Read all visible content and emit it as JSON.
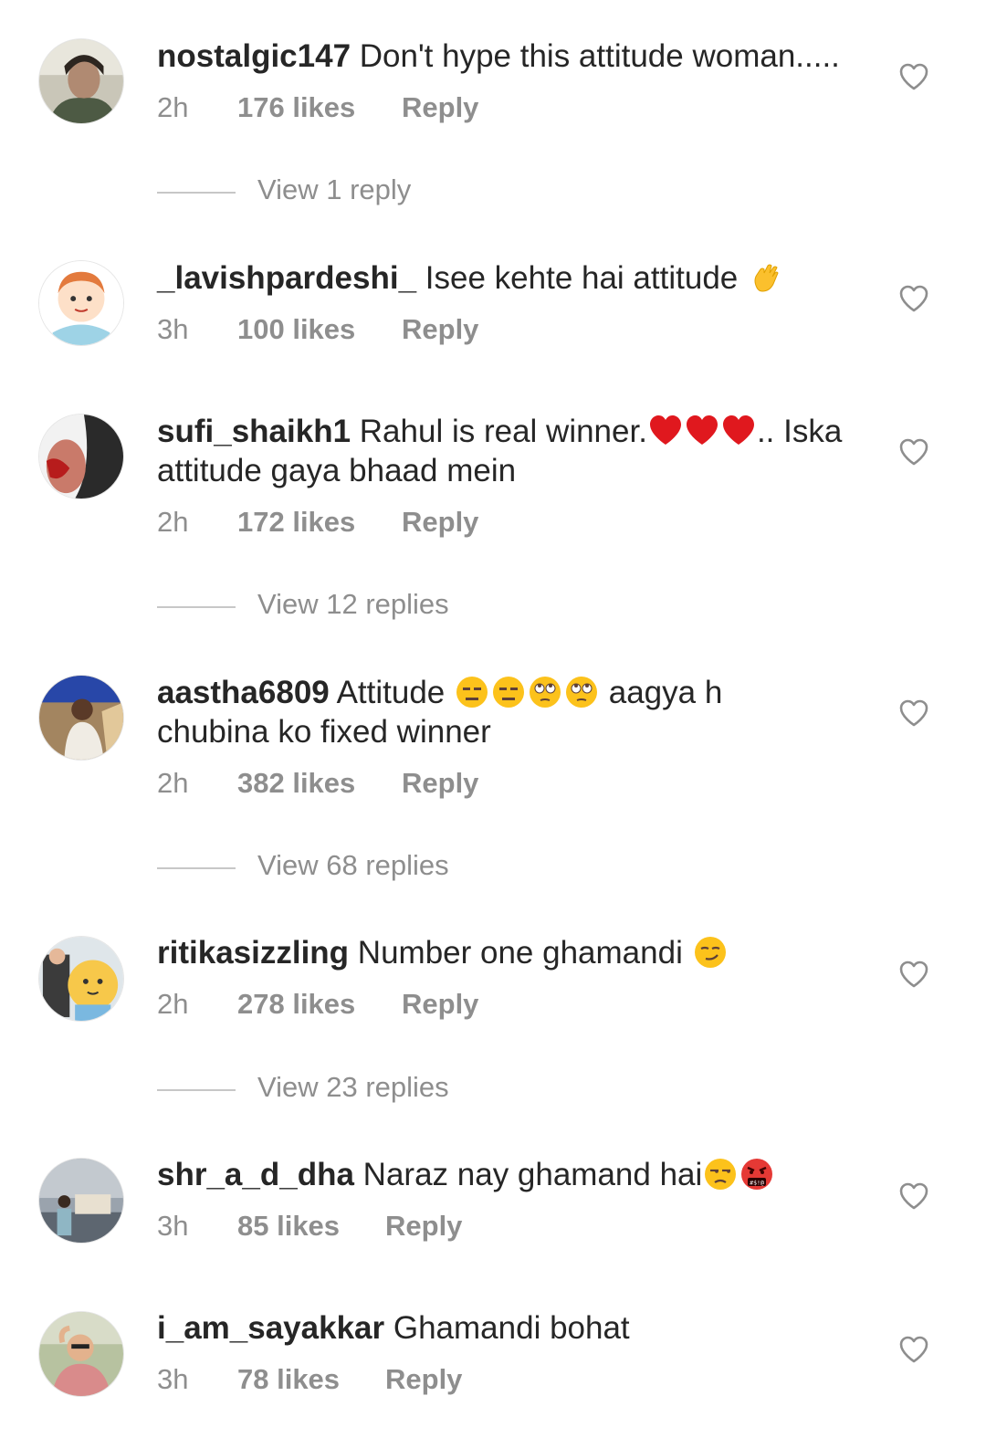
{
  "comments": [
    {
      "username": "nostalgic147",
      "text": "Don't hype this attitude woman.....",
      "time": "2h",
      "likes": "176 likes",
      "reply": "Reply",
      "view_replies": "View 1 reply"
    },
    {
      "username": "_lavishpardeshi_",
      "text": "Isee kehte hai attitude",
      "time": "3h",
      "likes": "100 likes",
      "reply": "Reply"
    },
    {
      "username": "sufi_shaikh1",
      "text1": "Rahul is real winner.",
      "text2": ".. Iska",
      "text3": "attitude gaya bhaad mein",
      "time": "2h",
      "likes": "172 likes",
      "reply": "Reply",
      "view_replies": "View 12 replies"
    },
    {
      "username": "aastha6809",
      "text1": "Attitude",
      "text2": "aagya h",
      "text3": "chubina ko fixed winner",
      "time": "2h",
      "likes": "382 likes",
      "reply": "Reply",
      "view_replies": "View 68 replies"
    },
    {
      "username": "ritikasizzling",
      "text": "Number one  ghamandi",
      "time": "2h",
      "likes": "278 likes",
      "reply": "Reply",
      "view_replies": "View 23 replies"
    },
    {
      "username": "shr_a_d_dha",
      "text": "Naraz nay ghamand hai",
      "time": "3h",
      "likes": "85 likes",
      "reply": "Reply"
    },
    {
      "username": "i_am_sayakkar",
      "text": "Ghamandi bohat",
      "time": "3h",
      "likes": "78 likes",
      "reply": "Reply"
    }
  ],
  "icons": {
    "like": "heart-outline-icon",
    "emoji_clap": "waving-hand-emoji",
    "emoji_heart": "red-heart-emoji",
    "emoji_expressionless": "expressionless-face-emoji",
    "emoji_eyeroll": "face-with-rolling-eyes-emoji",
    "emoji_smirk": "smirking-face-emoji",
    "emoji_unamused": "unamused-face-emoji",
    "emoji_swearing": "face-with-symbols-on-mouth-emoji"
  },
  "colors": {
    "text": "#262626",
    "meta": "#8e8e8e",
    "divider": "#c7c7c7"
  }
}
